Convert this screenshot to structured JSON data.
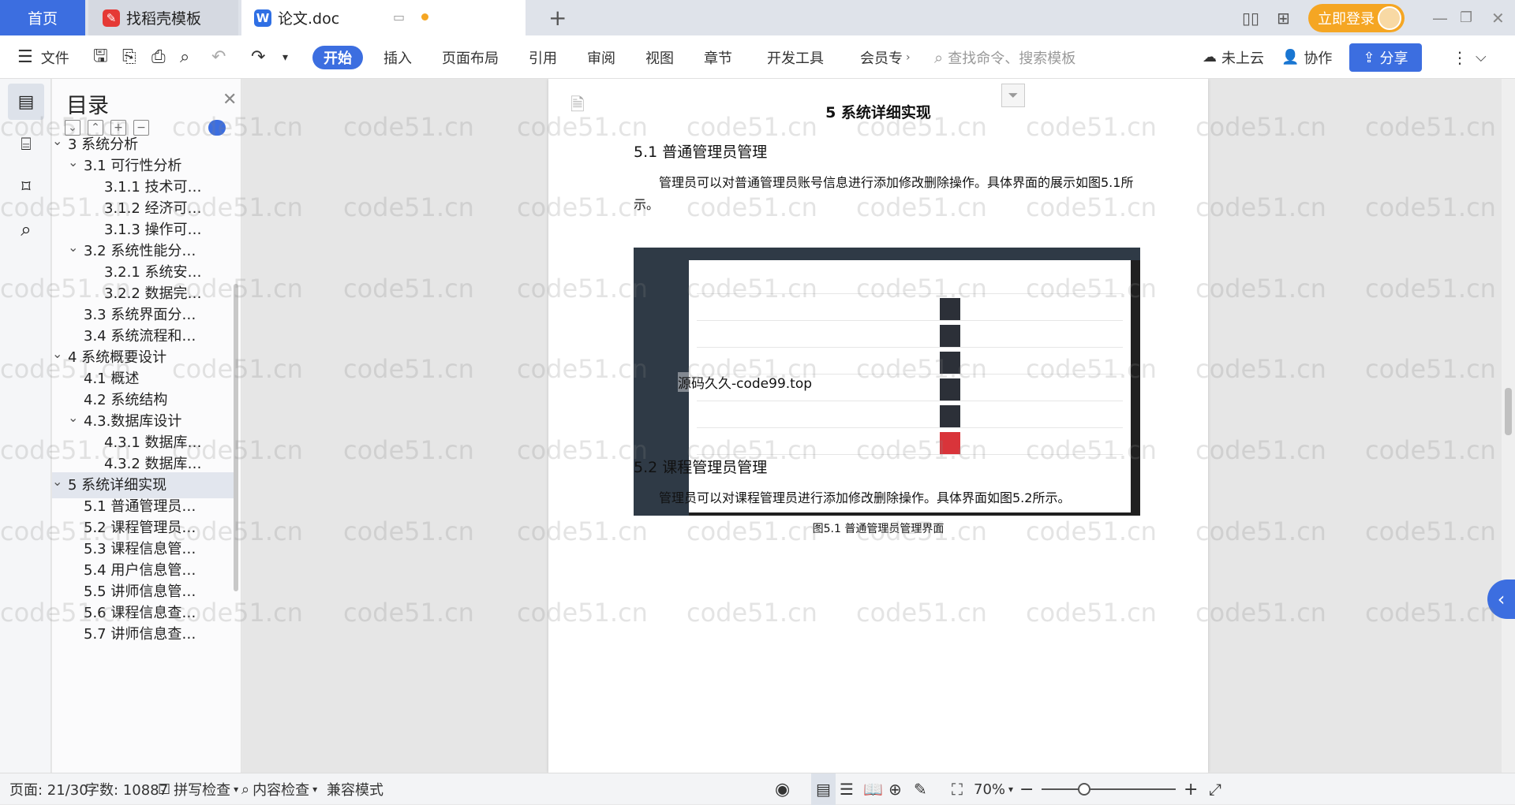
{
  "titlebar": {
    "tabs": [
      {
        "label": "首页"
      },
      {
        "label": "找稻壳模板"
      },
      {
        "label": "论文.doc"
      }
    ],
    "login_label": "立即登录"
  },
  "toolbar": {
    "file_label": "文件",
    "ribbon_tabs": [
      "开始",
      "插入",
      "页面布局",
      "引用",
      "审阅",
      "视图",
      "章节",
      "开发工具",
      "会员专"
    ],
    "search_placeholder": "查找命令、搜索模板",
    "cloud_label": "未上云",
    "collab_label": "协作",
    "share_label": "分享"
  },
  "toc": {
    "title": "目录",
    "items": [
      {
        "label": "3 系统分析",
        "level": 0
      },
      {
        "label": "3.1 可行性分析",
        "level": 1
      },
      {
        "label": "3.1.1 技术可…",
        "level": 2
      },
      {
        "label": "3.1.2 经济可…",
        "level": 2
      },
      {
        "label": "3.1.3 操作可…",
        "level": 2
      },
      {
        "label": "3.2 系统性能分…",
        "level": 1
      },
      {
        "label": "3.2.1  系统安…",
        "level": 2
      },
      {
        "label": "3.2.2  数据完…",
        "level": 2
      },
      {
        "label": "3.3 系统界面分…",
        "level": 1
      },
      {
        "label": "3.4 系统流程和…",
        "level": 1
      },
      {
        "label": "4 系统概要设计",
        "level": 0
      },
      {
        "label": "4.1 概述",
        "level": 1
      },
      {
        "label": "4.2 系统结构",
        "level": 1
      },
      {
        "label": "4.3.数据库设计",
        "level": 1
      },
      {
        "label": "4.3.1 数据库…",
        "level": 2
      },
      {
        "label": "4.3.2 数据库…",
        "level": 2
      },
      {
        "label": "5 系统详细实现",
        "level": 0
      },
      {
        "label": "5.1  普通管理员…",
        "level": 1
      },
      {
        "label": "5.2  课程管理员…",
        "level": 1
      },
      {
        "label": "5.3  课程信息管…",
        "level": 1
      },
      {
        "label": "5.4  用户信息管…",
        "level": 1
      },
      {
        "label": "5.5  讲师信息管…",
        "level": 1
      },
      {
        "label": "5.6  课程信息查…",
        "level": 1
      },
      {
        "label": "5.7  讲师信息查…",
        "level": 1
      }
    ],
    "selected_index": 16
  },
  "document": {
    "chapter_title": "5 系统详细实现",
    "section1_title": "5.1  普通管理员管理",
    "section1_para": "管理员可以对普通管理员账号信息进行添加修改删除操作。具体界面的展示如图5.1所示。",
    "figure_overlay": "源码久久-code99.top",
    "figure_caption": "图5.1  普通管理员管理界面",
    "section2_title": "5.2  课程管理员管理",
    "section2_para": "管理员可以对课程管理员进行添加修改删除操作。具体界面如图5.2所示。"
  },
  "watermark_text": "code51.cn",
  "statusbar": {
    "page_info": "页面: 21/30",
    "word_count": "字数: 10887",
    "spell_check": "拼写检查",
    "content_check": "内容检查",
    "compat_mode": "兼容模式",
    "zoom": "70%"
  }
}
